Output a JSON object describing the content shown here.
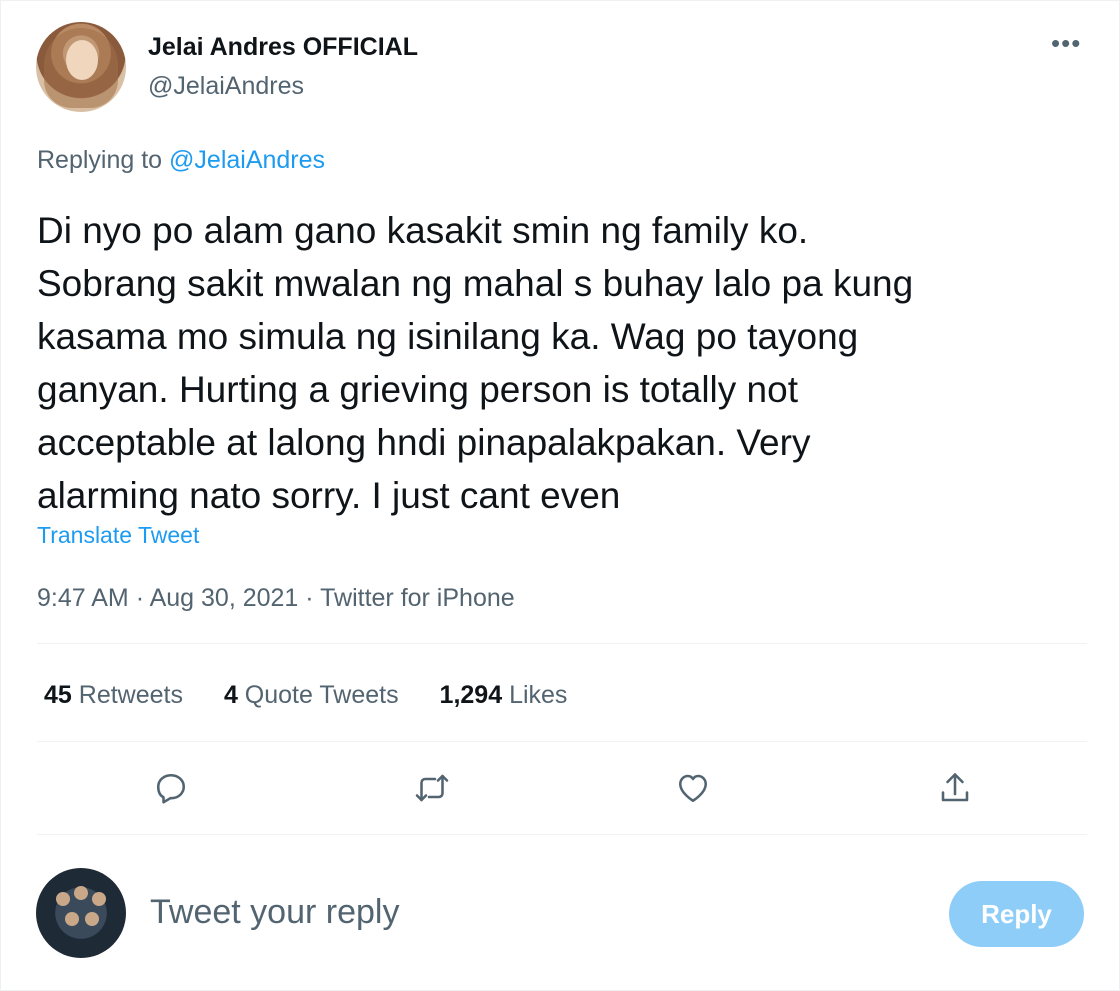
{
  "author": {
    "name": "Jelai Andres OFFICIAL",
    "handle": "@JelaiAndres"
  },
  "menu_icon": "more-horizontal-icon",
  "replying": {
    "prefix": "Replying to",
    "mention": "@JelaiAndres"
  },
  "tweet": {
    "text": "Di nyo po alam gano kasakit smin ng family ko.\nSobrang sakit mwalan ng mahal s buhay lalo pa kung\nkasama mo simula ng isinilang ka. Wag po tayong\nganyan. Hurting a grieving person is totally not\nacceptable at lalong hndi pinapalakpakan. Very\nalarming nato sorry. I just cant even",
    "translate_label": "Translate Tweet",
    "time": "9:47 AM",
    "date": "Aug 30, 2021",
    "source": "Twitter for iPhone"
  },
  "stats": {
    "retweets": {
      "count": "45",
      "label": "Retweets"
    },
    "quotes": {
      "count": "4",
      "label": "Quote Tweets"
    },
    "likes": {
      "count": "1,294",
      "label": "Likes"
    }
  },
  "actions": [
    {
      "icon": "reply-icon"
    },
    {
      "icon": "retweet-icon"
    },
    {
      "icon": "like-icon"
    },
    {
      "icon": "share-icon"
    }
  ],
  "reply_box": {
    "placeholder": "Tweet your reply",
    "button_label": "Reply"
  },
  "colors": {
    "accent": "#1d9bf0",
    "reply_button_disabled": "#8ecdf8",
    "secondary_text": "#536471"
  }
}
